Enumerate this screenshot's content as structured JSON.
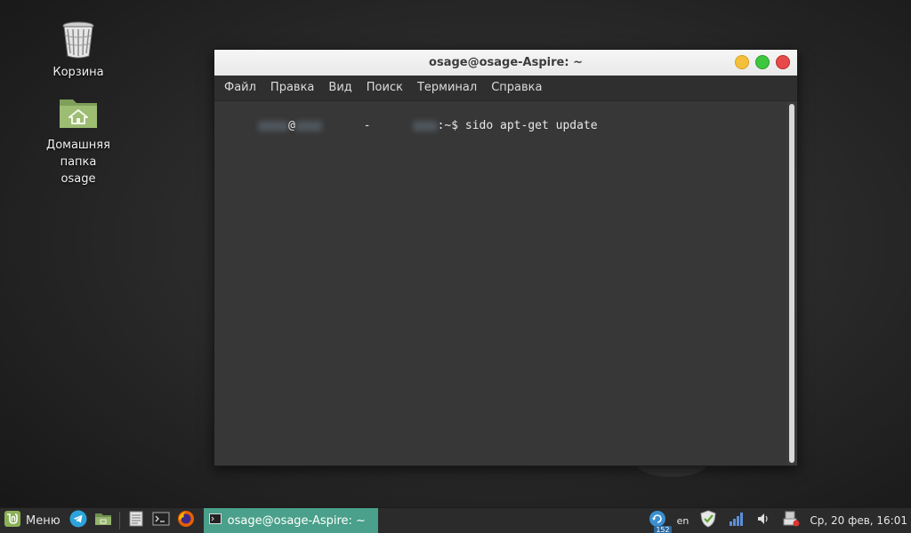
{
  "desktop": {
    "trash_label": "Корзина",
    "home_label_line1": "Домашняя папка",
    "home_label_line2": "osage"
  },
  "terminal": {
    "title": "osage@osage-Aspire: ~",
    "menu": [
      "Файл",
      "Правка",
      "Вид",
      "Поиск",
      "Терминал",
      "Справка"
    ],
    "prompt_at": "@",
    "prompt_dash": "-",
    "prompt_suffix": ":~$ ",
    "command": "sido apt-get update"
  },
  "taskbar": {
    "menu_label": "Меню",
    "active_task": "osage@osage-Aspire: ~",
    "tray": {
      "update_count": "152",
      "keyboard_layout": "en",
      "clock": "Ср, 20 фев, 16:01"
    }
  },
  "colors": {
    "mint_green": "#8bb158",
    "task_active": "#4aa08a"
  },
  "icons": [
    "trash-icon",
    "home-folder-icon",
    "mint-menu-icon",
    "telegram-icon",
    "files-icon",
    "text-editor-icon",
    "terminal-icon",
    "firefox-icon",
    "update-manager-icon",
    "shield-icon",
    "signal-icon",
    "volume-icon",
    "network-icon"
  ]
}
